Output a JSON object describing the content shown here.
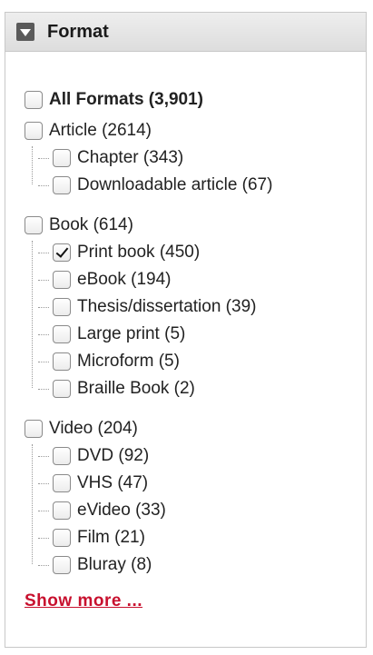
{
  "facet": {
    "title": "Format",
    "all_label": "All Formats (3,901)",
    "show_more": "Show more ...",
    "groups": [
      {
        "label": "Article (2614)",
        "children": [
          {
            "label": "Chapter (343)",
            "checked": false
          },
          {
            "label": "Downloadable article (67)",
            "checked": false
          }
        ]
      },
      {
        "label": "Book (614)",
        "children": [
          {
            "label": "Print book (450)",
            "checked": true
          },
          {
            "label": "eBook (194)",
            "checked": false
          },
          {
            "label": "Thesis/dissertation (39)",
            "checked": false
          },
          {
            "label": "Large print (5)",
            "checked": false
          },
          {
            "label": "Microform (5)",
            "checked": false
          },
          {
            "label": "Braille Book (2)",
            "checked": false
          }
        ]
      },
      {
        "label": "Video (204)",
        "children": [
          {
            "label": "DVD (92)",
            "checked": false
          },
          {
            "label": "VHS (47)",
            "checked": false
          },
          {
            "label": "eVideo (33)",
            "checked": false
          },
          {
            "label": "Film (21)",
            "checked": false
          },
          {
            "label": "Bluray (8)",
            "checked": false
          }
        ]
      }
    ]
  },
  "colors": {
    "link": "#c8102e",
    "header_bg": "#dddddd",
    "border": "#c8c8c8"
  }
}
